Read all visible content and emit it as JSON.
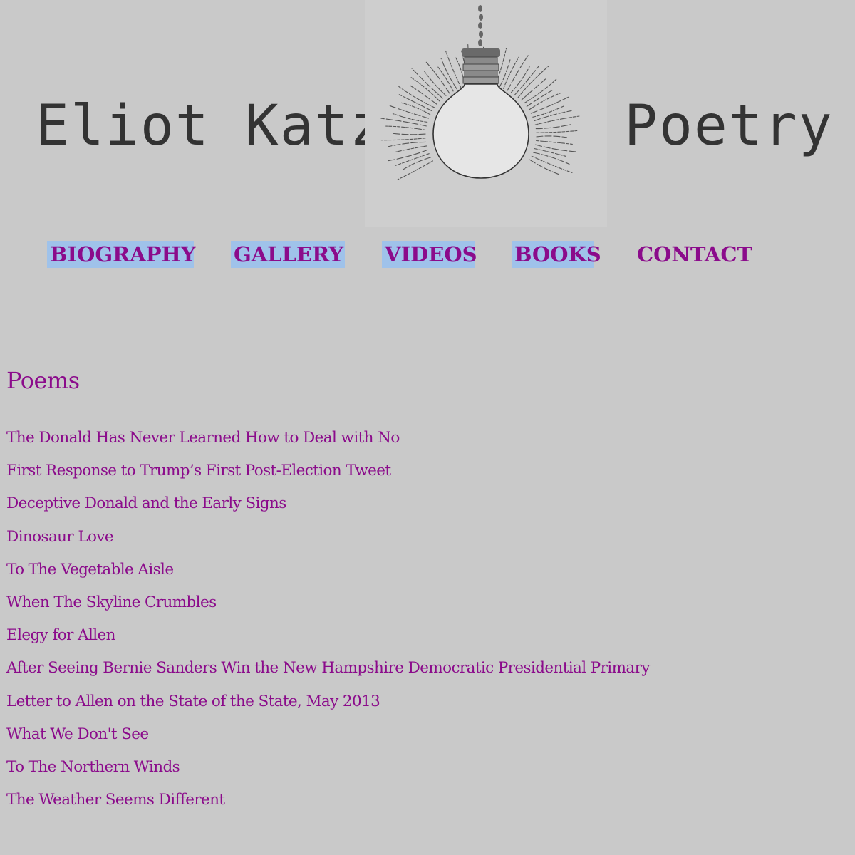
{
  "header": {
    "title_left": "Eliot Katz",
    "title_right": "Poetry",
    "logo_icon": "hanging-light-bulb-icon"
  },
  "nav": {
    "items": [
      {
        "label": "BIOGRAPHY",
        "selected": true
      },
      {
        "label": "GALLERY",
        "selected": true
      },
      {
        "label": "VIDEOS",
        "selected": true
      },
      {
        "label": "BOOKS",
        "selected": true
      },
      {
        "label": "CONTACT",
        "selected": false
      }
    ]
  },
  "main": {
    "section_title": "Poems",
    "poems": [
      "The Donald Has Never Learned How to Deal with No",
      "First Response to Trump’s First Post-Election Tweet",
      "Deceptive Donald and the Early Signs",
      "Dinosaur Love",
      "To The Vegetable Aisle",
      "When The Skyline Crumbles",
      "Elegy for Allen",
      "After Seeing Bernie Sanders Win the New Hampshire Democratic Presidential Primary",
      "Letter to Allen on the State of the State, May 2013",
      "What We Don't See",
      "To The Northern Winds",
      "The Weather Seems Different"
    ]
  },
  "colors": {
    "background": "#c9c9c9",
    "link": "#8b0b8b",
    "selection_highlight": "#9fc2ea",
    "logo_text": "#333333"
  }
}
